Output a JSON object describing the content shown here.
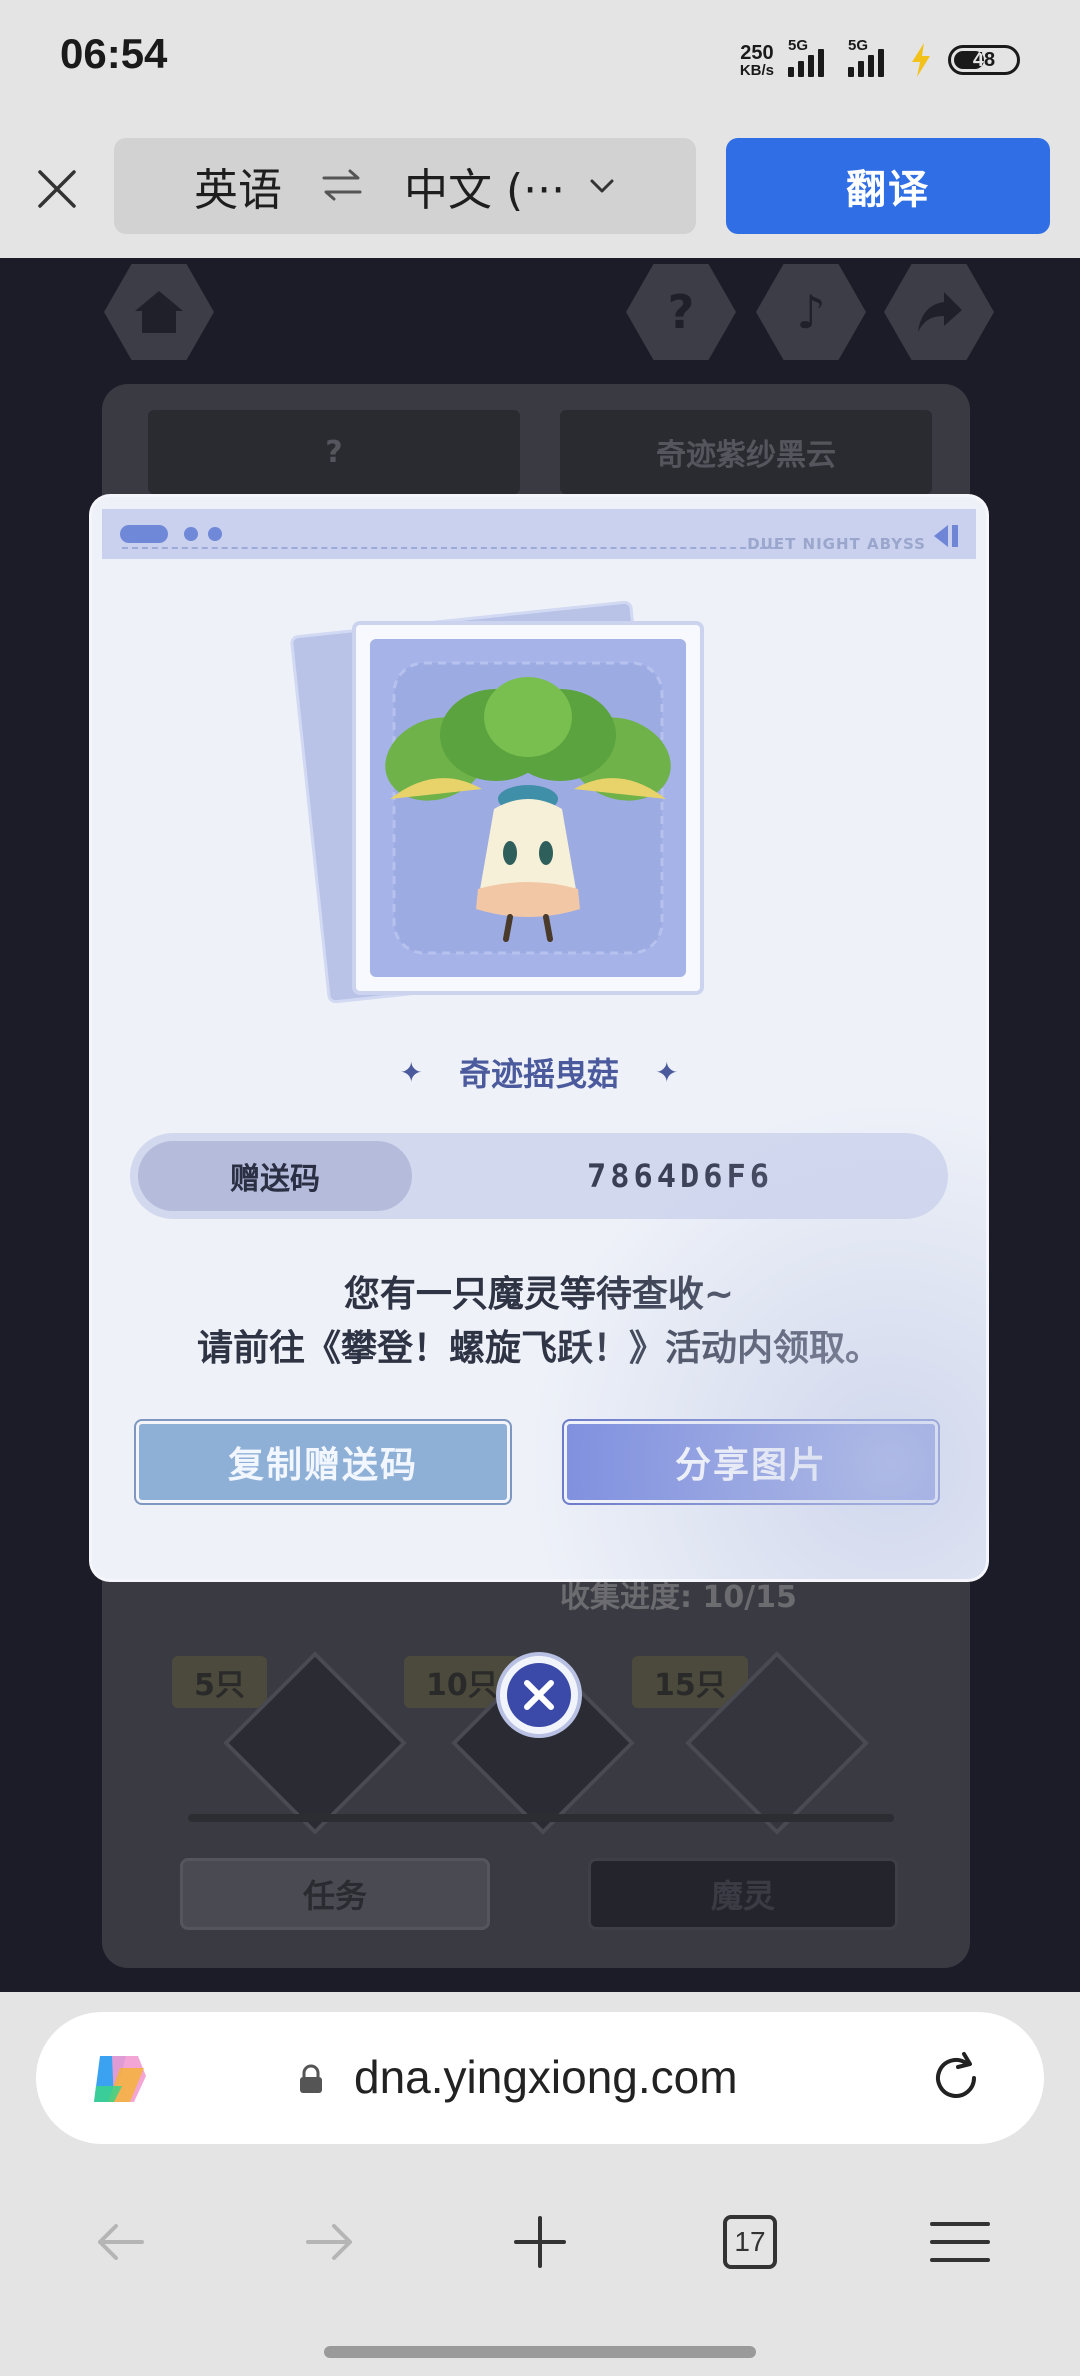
{
  "status_bar": {
    "time": "06:54",
    "net_speed_value": "250",
    "net_speed_unit": "KB/s",
    "signal1_label": "5G",
    "signal2_label": "5G",
    "battery_level": "48"
  },
  "translate_bar": {
    "source_lang": "英语",
    "target_lang": "中文 (···",
    "translate_button": "翻译"
  },
  "game_bg": {
    "tab_left": "?",
    "tab_right": "奇迹紫纱黑云",
    "progress": "收集进度: 10/15",
    "badge_5": "5只",
    "badge_10": "10只",
    "badge_15": "15只",
    "btn_tasks": "任务",
    "btn_spirits": "魔灵"
  },
  "modal": {
    "brand": "DUET NIGHT ABYSS",
    "spirit_name": "奇迹摇曳菇",
    "code_label": "赠送码",
    "code_value": "7864D6F6",
    "message_line1": "您有一只魔灵等待查收~",
    "message_line2": "请前往《攀登！螺旋飞跃！》活动内领取。",
    "copy_button": "复制赠送码",
    "share_button": "分享图片"
  },
  "browser": {
    "url": "dna.yingxiong.com",
    "tab_count": "17"
  },
  "colors": {
    "translate_accent": "#2f6ee4",
    "share_button": "#7b8cde",
    "copy_button": "#8fb0d6"
  },
  "icons": [
    "close-icon",
    "swap-icon",
    "chevron-down-icon",
    "home-icon",
    "help-icon",
    "music-icon",
    "share-icon",
    "copilot-icon",
    "lock-icon",
    "reload-icon",
    "back-icon",
    "forward-icon",
    "new-tab-icon",
    "tabs-icon",
    "menu-icon"
  ]
}
